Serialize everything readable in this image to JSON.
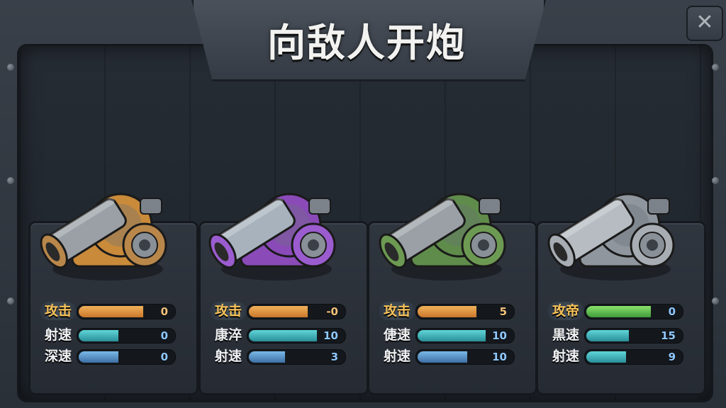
{
  "title": "向敌人开炮",
  "close_icon": "close-icon",
  "cannons": [
    {
      "name": "bronze-cannon",
      "colors": {
        "barrel": "#9aa0a6",
        "body": "#c98a3a",
        "wheel": "#b9874a"
      },
      "stats": [
        {
          "label": "攻击",
          "value": "0",
          "fill": 0.68,
          "color": "orange"
        },
        {
          "label": "射速",
          "value": "0",
          "fill": 0.42,
          "color": "teal"
        },
        {
          "label": "深速",
          "value": "0",
          "fill": 0.42,
          "color": "blue"
        }
      ]
    },
    {
      "name": "purple-cannon",
      "colors": {
        "barrel": "#a7b2bd",
        "body": "#8a4ab8",
        "wheel": "#9b5ccf"
      },
      "stats": [
        {
          "label": "攻击",
          "value": "-0",
          "fill": 0.62,
          "color": "orange"
        },
        {
          "label": "康淬",
          "value": "10",
          "fill": 0.72,
          "color": "teal"
        },
        {
          "label": "射速",
          "value": "3",
          "fill": 0.38,
          "color": "blue"
        }
      ]
    },
    {
      "name": "green-cannon",
      "colors": {
        "barrel": "#9aa0a6",
        "body": "#5f8c4a",
        "wheel": "#6d9a52"
      },
      "stats": [
        {
          "label": "攻击",
          "value": "5",
          "fill": 0.62,
          "color": "orange"
        },
        {
          "label": "倢速",
          "value": "10",
          "fill": 0.72,
          "color": "teal"
        },
        {
          "label": "射速",
          "value": "10",
          "fill": 0.52,
          "color": "blue"
        }
      ]
    },
    {
      "name": "steel-cannon",
      "colors": {
        "barrel": "#b6bcc2",
        "body": "#8f969d",
        "wheel": "#a7adb3"
      },
      "stats": [
        {
          "label": "攻帝",
          "value": "0",
          "fill": 0.68,
          "color": "green"
        },
        {
          "label": "黒速",
          "value": "15",
          "fill": 0.45,
          "color": "teal"
        },
        {
          "label": "射速",
          "value": "9",
          "fill": 0.42,
          "color": "teal"
        }
      ]
    }
  ]
}
